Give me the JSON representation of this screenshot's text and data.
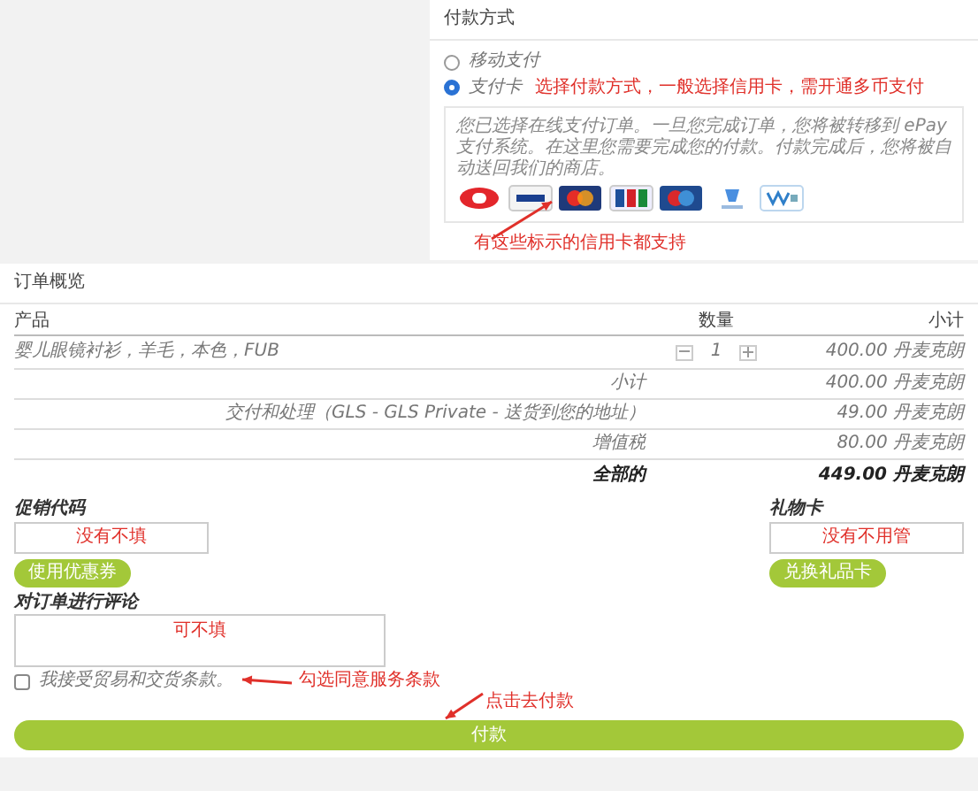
{
  "payment": {
    "title": "付款方式",
    "options": [
      {
        "label": "移动支付",
        "selected": false
      },
      {
        "label": "支付卡",
        "selected": true,
        "note": "选择付款方式，一般选择信用卡，需开通多币支付"
      }
    ],
    "description": "您已选择在线支付订单。一旦您完成订单，您将被转移到 ePay 支付系统。在这里您需要完成您的付款。付款完成后，您将被自动送回我们的商店。",
    "card_logos": [
      {
        "kind": "dankort"
      },
      {
        "kind": "visa"
      },
      {
        "kind": "mastercard"
      },
      {
        "kind": "jcb"
      },
      {
        "kind": "maestro"
      },
      {
        "kind": "mobilepay"
      },
      {
        "kind": "wallet"
      }
    ],
    "note": "有这些标示的信用卡都支持"
  },
  "order": {
    "title": "订单概览",
    "columns": [
      "产品",
      "数量",
      "小计"
    ],
    "items": [
      {
        "product": "婴儿眼镜衬衫，羊毛，本色，FUB",
        "quantity": "1",
        "subtotal": "400.00 丹麦克朗"
      }
    ],
    "totals": [
      {
        "label": "小计",
        "value": "400.00 丹麦克朗",
        "bold": false
      },
      {
        "label": "交付和处理（GLS - GLS Private - 送货到您的地址）",
        "value": "49.00 丹麦克朗",
        "bold": false
      },
      {
        "label": "增值税",
        "value": "80.00 丹麦克朗",
        "bold": false
      },
      {
        "label": "全部的",
        "value": "449.00 丹麦克朗",
        "bold": true
      }
    ],
    "promo": {
      "label": "促销代码",
      "note": "没有不填",
      "button": "使用优惠券"
    },
    "gift_card": {
      "label": "礼物卡",
      "note": "没有不用管",
      "button": "兑换礼品卡"
    },
    "comment": {
      "label": "对订单进行评论",
      "note": "可不填"
    },
    "terms": {
      "label": "我接受贸易和交货条款。",
      "checked": false,
      "note": "勾选同意服务条款"
    },
    "pay": {
      "note": "点击去付款",
      "button": "付款"
    }
  }
}
